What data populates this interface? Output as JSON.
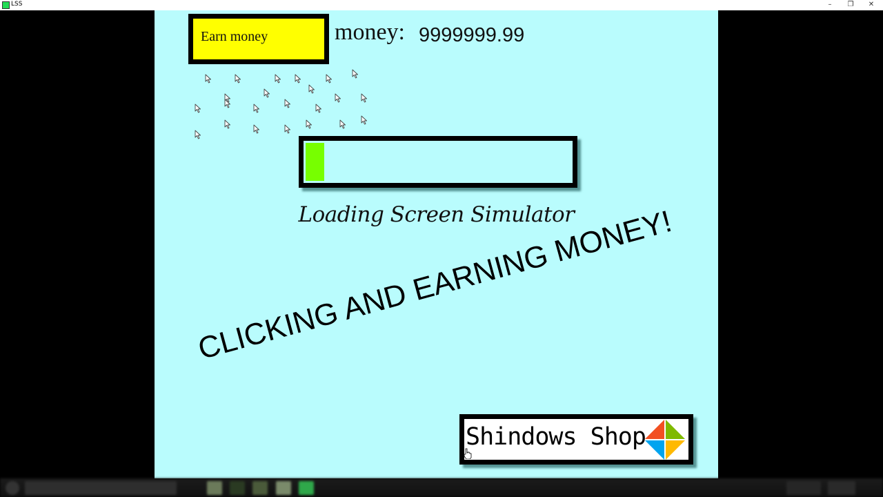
{
  "window": {
    "title": "LSS",
    "controls": {
      "minimize": "–",
      "restore": "❐",
      "close": "✕"
    }
  },
  "game": {
    "earn_button_label": "Earn money",
    "money_label": "money:",
    "money_value": "9999999.99",
    "auto_clicker_count": 23,
    "progress_percent": 7,
    "progress_color": "#77ff00",
    "title": "Loading Screen Simulator",
    "slogan": "CLICKING AND EARNING MONEY!",
    "shop_label": "Shindows Shop",
    "shop_logo_colors": {
      "top_left": "#f25022",
      "top_right": "#7fba00",
      "bottom_left": "#00a4ef",
      "bottom_right": "#ffb900"
    },
    "background_color": "#b9fcfd",
    "earn_button_color": "#ffff00"
  },
  "icons": {
    "cursor": "arrow-cursor-icon",
    "hand": "hand-pointer-icon",
    "shop_logo": "shindows-logo-icon"
  }
}
